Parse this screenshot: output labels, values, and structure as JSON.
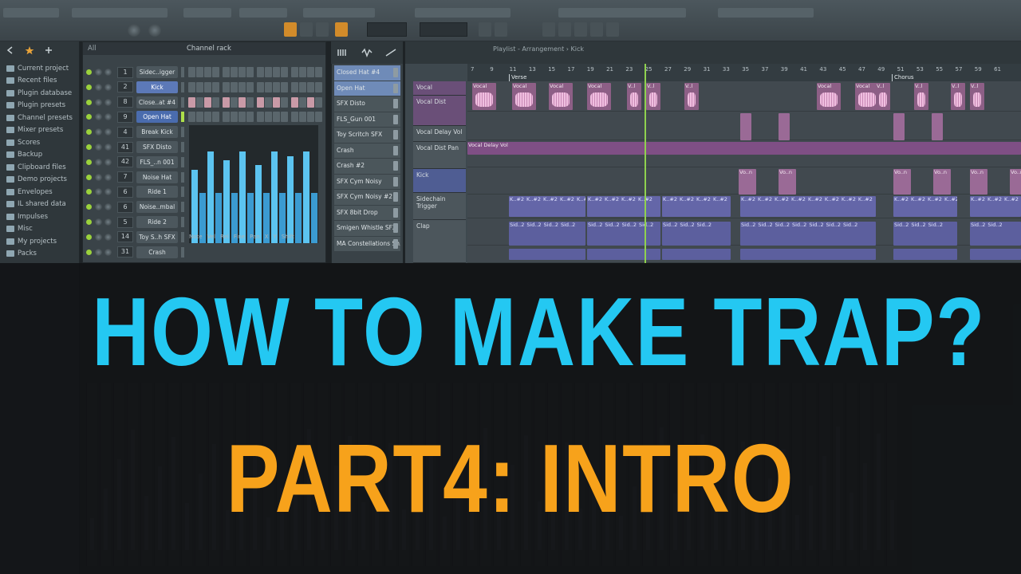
{
  "browser": {
    "items": [
      {
        "label": "Current project"
      },
      {
        "label": "Recent files"
      },
      {
        "label": "Plugin database"
      },
      {
        "label": "Plugin presets"
      },
      {
        "label": "Channel presets"
      },
      {
        "label": "Mixer presets"
      },
      {
        "label": "Scores"
      },
      {
        "label": "Backup"
      },
      {
        "label": "Clipboard files"
      },
      {
        "label": "Demo projects"
      },
      {
        "label": "Envelopes"
      },
      {
        "label": "IL shared data"
      },
      {
        "label": "Impulses"
      },
      {
        "label": "Misc"
      },
      {
        "label": "My projects"
      },
      {
        "label": "Packs"
      }
    ],
    "filter": "All"
  },
  "channel_rack": {
    "title": "Channel rack",
    "channels": [
      {
        "num": "1",
        "name": "Sidec..igger"
      },
      {
        "num": "2",
        "name": "Kick"
      },
      {
        "num": "8",
        "name": "Close..at #4"
      },
      {
        "num": "9",
        "name": "Open Hat"
      },
      {
        "num": "4",
        "name": "Break Kick"
      },
      {
        "num": "41",
        "name": "SFX Disto"
      },
      {
        "num": "42",
        "name": "FLS_..n 001"
      },
      {
        "num": "7",
        "name": "Noise Hat"
      },
      {
        "num": "6",
        "name": "Ride 1"
      },
      {
        "num": "6",
        "name": "Noise..mbal"
      },
      {
        "num": "5",
        "name": "Ride 2"
      },
      {
        "num": "14",
        "name": "Toy S..h SFX"
      },
      {
        "num": "31",
        "name": "Crash"
      }
    ],
    "velocity_tabs": [
      "Note",
      "Vel",
      "Rel",
      "Fine",
      "Pan",
      "X",
      "Y",
      "Shift"
    ]
  },
  "picker": {
    "items": [
      {
        "label": "Closed Hat #4"
      },
      {
        "label": "Open Hat"
      },
      {
        "label": "SFX Disto"
      },
      {
        "label": "FLS_Gun 001"
      },
      {
        "label": "Toy Scritch SFX"
      },
      {
        "label": "Crash"
      },
      {
        "label": "Crash #2"
      },
      {
        "label": "SFX Cym Noisy"
      },
      {
        "label": "SFX Cym Noisy #2"
      },
      {
        "label": "SFX 8bit Drop"
      },
      {
        "label": "Smigen Whistle SFX"
      },
      {
        "label": "MA Constellations Sh..."
      }
    ]
  },
  "playlist": {
    "title": "Playlist - Arrangement › Kick",
    "ruler": [
      "7",
      "9",
      "11",
      "13",
      "15",
      "17",
      "19",
      "21",
      "23",
      "25",
      "27",
      "29",
      "31",
      "33",
      "35",
      "37",
      "39",
      "41",
      "43",
      "45",
      "47",
      "49",
      "51",
      "53",
      "55",
      "57",
      "59",
      "61"
    ],
    "markers": [
      {
        "label": "Verse"
      },
      {
        "label": "Chorus"
      }
    ],
    "tracks": [
      {
        "label": "Vocal"
      },
      {
        "label": "Vocal Dist"
      },
      {
        "label": "Vocal Delay Vol"
      },
      {
        "label": "Vocal Dist Pan"
      },
      {
        "label": "Kick"
      },
      {
        "label": "Sidechain Trigger"
      },
      {
        "label": "Clap"
      }
    ],
    "clip_labels": {
      "vocal": "Vocal",
      "vocal_short": "V..l",
      "vocal_delay": "Vocal Delay Vol",
      "vo_n": "Vo..n",
      "kick": "K..#2",
      "sidechain": "Sid..2"
    }
  },
  "title": {
    "line1": "HOW TO MAKE TRAP?",
    "line2": "PART4: INTRO"
  },
  "colors": {
    "line1": "#24c8f2",
    "line2": "#f7a21b",
    "accent_green": "#8fd14f"
  }
}
